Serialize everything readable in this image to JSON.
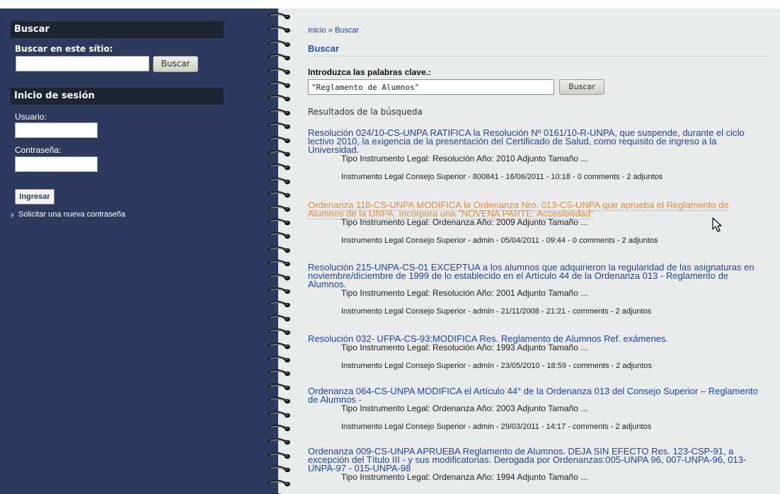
{
  "sidebar": {
    "search_block_title": "Buscar",
    "search_label": "Buscar en este sítio:",
    "search_value": "",
    "search_button": "Buscar",
    "login_block_title": "Inicio de sesión",
    "username_label": "Usuario:",
    "username_value": "",
    "password_label": "Contraseña:",
    "password_value": "",
    "login_button": "Ingresar",
    "new_password_link": "Solicitar una nueva contraseña"
  },
  "main": {
    "breadcrumb": {
      "home": "Inicio",
      "separator": "»",
      "current": "Buscar"
    },
    "page_title": "Buscar",
    "keywords_label": "Introduzca las palabras clave.:",
    "keywords_value": "\"Reglamento de Alumnos\"",
    "search_button": "Buscar",
    "results_heading": "Resultados de la búsqueda",
    "results": [
      {
        "title": "Resolución 024/10-CS-UNPA RATIFICA la Resolución Nº 0161/10-R-UNPA, que suspende, durante el ciclo lectivo 2010, la exigencia de la presentación del Certificado de Salud, como requisito de ingreso a la Universidad.",
        "snippet": "Tipo Instrumento Legal:  Resolución Año:  2010 Adjunto Tamaño ...",
        "meta": "Instrumento Legal Consejo Superior - 800841 - 16/06/2011 - 10:18 - 0 comments - 2 adjuntos"
      },
      {
        "title": "Ordenanza 118-CS-UNPA MODIFICA la Ordenanza Nro. 013-CS-UNPA que aprueba el Reglamento de Alumnos de la UNPA. Incorpora una \"NOVENA PARTE: Accesibilidad\"",
        "snippet": "Tipo Instrumento Legal:  Ordenanza Año:  2009 Adjunto Tamaño ...",
        "meta": "Instrumento Legal Consejo Superior - admin - 05/04/2011 - 09:44 - 0 comments - 2 adjuntos"
      },
      {
        "title": "Resolución 215-UNPA-CS-01 EXCEPTUA a los alumnos que adquirieron la regularidad de las asignaturas en noviembre/diciembre de 1999 de lo establecido en el Artículo 44 de la Ordenanza 013 - Reglamento de Alumnos.",
        "snippet": "Tipo Instrumento Legal:  Resolución Año:  2001 Adjunto Tamaño ...",
        "meta": "Instrumento Legal Consejo Superior - admin - 21/11/2008 - 21:21 - comments - 2 adjuntos"
      },
      {
        "title": "Resolución 032- UFPA-CS-93:MODIFICA Res. Reglamento de Alumnos Ref. exámenes.",
        "snippet": "Tipo Instrumento Legal:  Resolución Año:  1993 Adjunto Tamaño ...",
        "meta": "Instrumento Legal Consejo Superior - admin - 23/05/2010 - 18:59 - comments - 2 adjuntos"
      },
      {
        "title": "Ordenanza 064-CS-UNPA MODIFICA el Artículo 44° de la Ordenanza 013 del Consejo Superior – Reglamento de Alumnos -",
        "snippet": "Tipo Instrumento Legal:  Ordenanza Año:  2003 Adjunto Tamaño ...",
        "meta": "Instrumento Legal Consejo Superior - admin - 29/03/2011 - 14:17 - comments - 2 adjuntos"
      },
      {
        "title": "Ordenanza 009-CS-UNPA APRUEBA Reglamento de Alumnos. DEJA SIN EFECTO Res. 123-CSP-91, a excepción del Título III - y sus modificatorias. Derogada por Ordenanzas:005-UNPA 96, 007-UNPA-96, 013-UNPA-97 - 015-UNPA-98",
        "snippet": "Tipo Instrumento Legal:  Ordenanza Año:  1994 Adjunto Tamaño ...",
        "meta": ""
      }
    ]
  },
  "colors": {
    "sidebar_bg": "#2c3a5e",
    "block_title_bg": "#1e2431",
    "link": "#1c45a8",
    "link_hover": "#ef8a2e",
    "content_bg": "#e9eaea"
  }
}
